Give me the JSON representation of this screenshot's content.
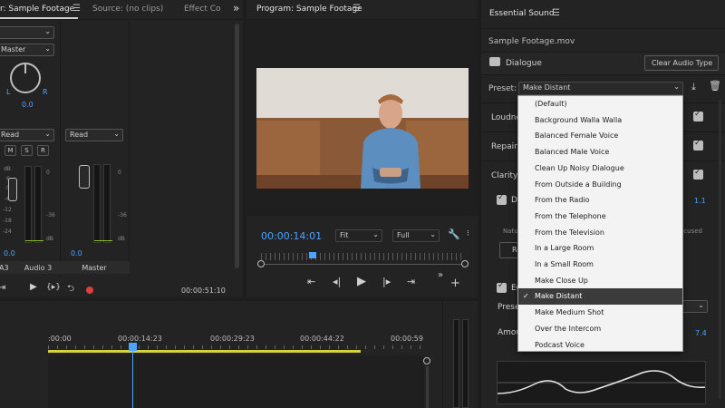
{
  "mixer": {
    "tabs": [
      "r: Sample Footage",
      "Source: (no clips)",
      "Effect Co"
    ],
    "overflow": "»",
    "master_label": "Master",
    "pan_value": "0.0",
    "pan_L": "L",
    "pan_R": "R",
    "read_1": "Read",
    "read_2": "Read",
    "m": "M",
    "s": "S",
    "r": "R",
    "scale_left": [
      "dB",
      "6",
      "0",
      "-6",
      "-12",
      "-18",
      "-24",
      "dB"
    ],
    "scale_meter": [
      "0",
      "-36",
      "dB"
    ],
    "vol_1": "0.0",
    "vol_2": "0.0",
    "tracks": [
      "A3",
      "Audio 3",
      "Master"
    ],
    "timecode": "00:00:51:10"
  },
  "program": {
    "title": "Program: Sample Footage",
    "timecode": "00:00:14:01",
    "fit": "Fit",
    "full": "Full"
  },
  "essential_sound": {
    "title": "Essential Sound",
    "file": "Sample Footage.mov",
    "type_label": "Dialogue",
    "clear_button": "Clear Audio Type",
    "preset_label": "Preset:",
    "preset_value": "Make Distant",
    "sections": [
      "Loudne",
      "Repair",
      "Clarity"
    ],
    "dy_label": "Dy",
    "dy_value": "1.1",
    "natu": "Natu",
    "focused": "ocused",
    "re": "Re",
    "eq_label": "EC",
    "preset2": "Prese",
    "amount": "Amou",
    "amount_value": "7.4"
  },
  "preset_options": [
    "(Default)",
    "Background Walla Walla",
    "Balanced Female Voice",
    "Balanced Male Voice",
    "Clean Up Noisy Dialogue",
    "From Outside a Building",
    "From the Radio",
    "From the Telephone",
    "From the Television",
    "In a Large Room",
    "In a Small Room",
    "Make Close Up",
    "Make Distant",
    "Make Medium Shot",
    "Over the Intercom",
    "Podcast Voice"
  ],
  "selected_preset_index": 12,
  "timeline": {
    "ticks": [
      ":00:00",
      "00:00:14:23",
      "00:00:29:23",
      "00:00:44:22",
      "00:00:59"
    ]
  },
  "colors": {
    "accent": "#4da3ff",
    "work_area": "#d7d13a",
    "record": "#e0403a"
  }
}
